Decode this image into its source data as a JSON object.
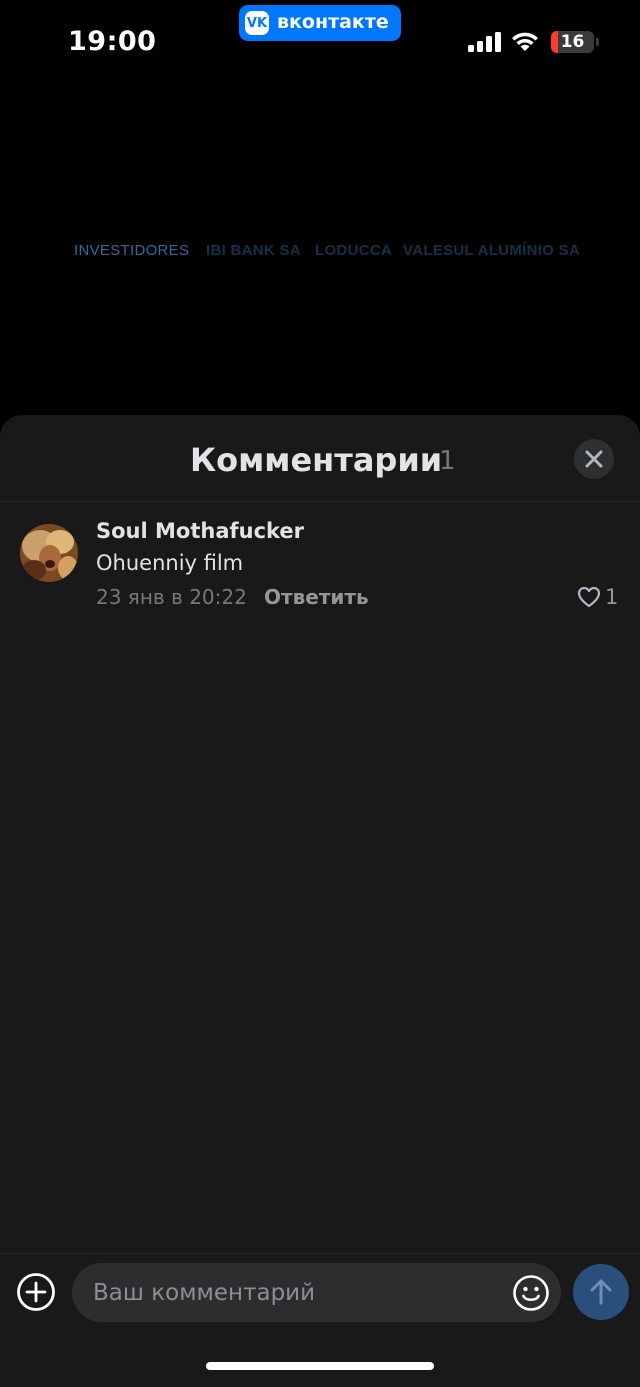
{
  "status_bar": {
    "time": "19:00",
    "app_badge": "вконтакте",
    "app_badge_logo": "VK",
    "battery_level": "16",
    "icons": [
      "signal-icon",
      "wifi-icon",
      "battery-icon"
    ]
  },
  "background": {
    "credits": [
      "INVESTIDORES",
      "IBI BANK SA",
      "LODUCCA",
      "VALESUL ALUMÍNIO SA"
    ]
  },
  "sheet": {
    "title": "Комментарии",
    "count": "1",
    "close_icon": "close-icon"
  },
  "comments": [
    {
      "author": "Soul Mothafucker",
      "text": "Ohuenniy film",
      "date": "23 янв в 20:22",
      "reply_label": "Ответить",
      "likes": "1"
    }
  ],
  "composer": {
    "placeholder": "Ваш комментарий",
    "value": "",
    "icons": [
      "add-icon",
      "emoji-icon",
      "send-arrow-icon"
    ]
  },
  "colors": {
    "accent": "#0077ff",
    "sheet_bg": "#19191a",
    "input_bg": "#2c2d2e",
    "send_bg": "#2a4f7a",
    "battery_low": "#ff3b30"
  }
}
